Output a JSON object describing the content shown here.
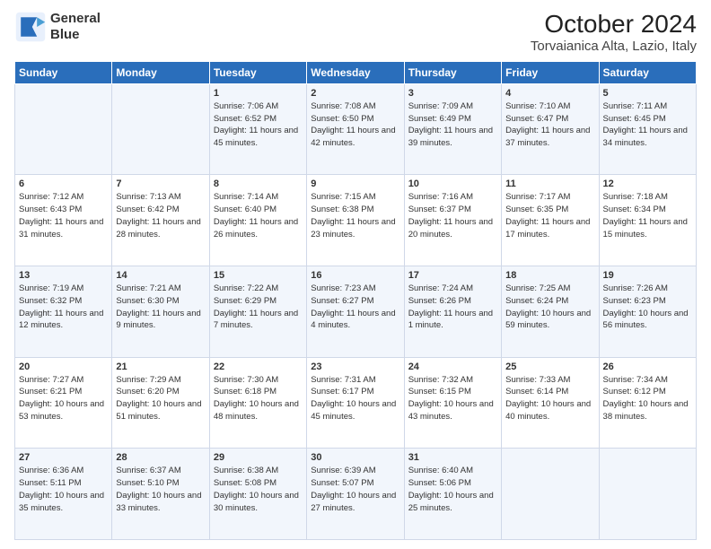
{
  "header": {
    "logo_line1": "General",
    "logo_line2": "Blue",
    "title": "October 2024",
    "subtitle": "Torvaianica Alta, Lazio, Italy"
  },
  "columns": [
    "Sunday",
    "Monday",
    "Tuesday",
    "Wednesday",
    "Thursday",
    "Friday",
    "Saturday"
  ],
  "rows": [
    [
      {
        "day": "",
        "sunrise": "",
        "sunset": "",
        "daylight": ""
      },
      {
        "day": "",
        "sunrise": "",
        "sunset": "",
        "daylight": ""
      },
      {
        "day": "1",
        "sunrise": "Sunrise: 7:06 AM",
        "sunset": "Sunset: 6:52 PM",
        "daylight": "Daylight: 11 hours and 45 minutes."
      },
      {
        "day": "2",
        "sunrise": "Sunrise: 7:08 AM",
        "sunset": "Sunset: 6:50 PM",
        "daylight": "Daylight: 11 hours and 42 minutes."
      },
      {
        "day": "3",
        "sunrise": "Sunrise: 7:09 AM",
        "sunset": "Sunset: 6:49 PM",
        "daylight": "Daylight: 11 hours and 39 minutes."
      },
      {
        "day": "4",
        "sunrise": "Sunrise: 7:10 AM",
        "sunset": "Sunset: 6:47 PM",
        "daylight": "Daylight: 11 hours and 37 minutes."
      },
      {
        "day": "5",
        "sunrise": "Sunrise: 7:11 AM",
        "sunset": "Sunset: 6:45 PM",
        "daylight": "Daylight: 11 hours and 34 minutes."
      }
    ],
    [
      {
        "day": "6",
        "sunrise": "Sunrise: 7:12 AM",
        "sunset": "Sunset: 6:43 PM",
        "daylight": "Daylight: 11 hours and 31 minutes."
      },
      {
        "day": "7",
        "sunrise": "Sunrise: 7:13 AM",
        "sunset": "Sunset: 6:42 PM",
        "daylight": "Daylight: 11 hours and 28 minutes."
      },
      {
        "day": "8",
        "sunrise": "Sunrise: 7:14 AM",
        "sunset": "Sunset: 6:40 PM",
        "daylight": "Daylight: 11 hours and 26 minutes."
      },
      {
        "day": "9",
        "sunrise": "Sunrise: 7:15 AM",
        "sunset": "Sunset: 6:38 PM",
        "daylight": "Daylight: 11 hours and 23 minutes."
      },
      {
        "day": "10",
        "sunrise": "Sunrise: 7:16 AM",
        "sunset": "Sunset: 6:37 PM",
        "daylight": "Daylight: 11 hours and 20 minutes."
      },
      {
        "day": "11",
        "sunrise": "Sunrise: 7:17 AM",
        "sunset": "Sunset: 6:35 PM",
        "daylight": "Daylight: 11 hours and 17 minutes."
      },
      {
        "day": "12",
        "sunrise": "Sunrise: 7:18 AM",
        "sunset": "Sunset: 6:34 PM",
        "daylight": "Daylight: 11 hours and 15 minutes."
      }
    ],
    [
      {
        "day": "13",
        "sunrise": "Sunrise: 7:19 AM",
        "sunset": "Sunset: 6:32 PM",
        "daylight": "Daylight: 11 hours and 12 minutes."
      },
      {
        "day": "14",
        "sunrise": "Sunrise: 7:21 AM",
        "sunset": "Sunset: 6:30 PM",
        "daylight": "Daylight: 11 hours and 9 minutes."
      },
      {
        "day": "15",
        "sunrise": "Sunrise: 7:22 AM",
        "sunset": "Sunset: 6:29 PM",
        "daylight": "Daylight: 11 hours and 7 minutes."
      },
      {
        "day": "16",
        "sunrise": "Sunrise: 7:23 AM",
        "sunset": "Sunset: 6:27 PM",
        "daylight": "Daylight: 11 hours and 4 minutes."
      },
      {
        "day": "17",
        "sunrise": "Sunrise: 7:24 AM",
        "sunset": "Sunset: 6:26 PM",
        "daylight": "Daylight: 11 hours and 1 minute."
      },
      {
        "day": "18",
        "sunrise": "Sunrise: 7:25 AM",
        "sunset": "Sunset: 6:24 PM",
        "daylight": "Daylight: 10 hours and 59 minutes."
      },
      {
        "day": "19",
        "sunrise": "Sunrise: 7:26 AM",
        "sunset": "Sunset: 6:23 PM",
        "daylight": "Daylight: 10 hours and 56 minutes."
      }
    ],
    [
      {
        "day": "20",
        "sunrise": "Sunrise: 7:27 AM",
        "sunset": "Sunset: 6:21 PM",
        "daylight": "Daylight: 10 hours and 53 minutes."
      },
      {
        "day": "21",
        "sunrise": "Sunrise: 7:29 AM",
        "sunset": "Sunset: 6:20 PM",
        "daylight": "Daylight: 10 hours and 51 minutes."
      },
      {
        "day": "22",
        "sunrise": "Sunrise: 7:30 AM",
        "sunset": "Sunset: 6:18 PM",
        "daylight": "Daylight: 10 hours and 48 minutes."
      },
      {
        "day": "23",
        "sunrise": "Sunrise: 7:31 AM",
        "sunset": "Sunset: 6:17 PM",
        "daylight": "Daylight: 10 hours and 45 minutes."
      },
      {
        "day": "24",
        "sunrise": "Sunrise: 7:32 AM",
        "sunset": "Sunset: 6:15 PM",
        "daylight": "Daylight: 10 hours and 43 minutes."
      },
      {
        "day": "25",
        "sunrise": "Sunrise: 7:33 AM",
        "sunset": "Sunset: 6:14 PM",
        "daylight": "Daylight: 10 hours and 40 minutes."
      },
      {
        "day": "26",
        "sunrise": "Sunrise: 7:34 AM",
        "sunset": "Sunset: 6:12 PM",
        "daylight": "Daylight: 10 hours and 38 minutes."
      }
    ],
    [
      {
        "day": "27",
        "sunrise": "Sunrise: 6:36 AM",
        "sunset": "Sunset: 5:11 PM",
        "daylight": "Daylight: 10 hours and 35 minutes."
      },
      {
        "day": "28",
        "sunrise": "Sunrise: 6:37 AM",
        "sunset": "Sunset: 5:10 PM",
        "daylight": "Daylight: 10 hours and 33 minutes."
      },
      {
        "day": "29",
        "sunrise": "Sunrise: 6:38 AM",
        "sunset": "Sunset: 5:08 PM",
        "daylight": "Daylight: 10 hours and 30 minutes."
      },
      {
        "day": "30",
        "sunrise": "Sunrise: 6:39 AM",
        "sunset": "Sunset: 5:07 PM",
        "daylight": "Daylight: 10 hours and 27 minutes."
      },
      {
        "day": "31",
        "sunrise": "Sunrise: 6:40 AM",
        "sunset": "Sunset: 5:06 PM",
        "daylight": "Daylight: 10 hours and 25 minutes."
      },
      {
        "day": "",
        "sunrise": "",
        "sunset": "",
        "daylight": ""
      },
      {
        "day": "",
        "sunrise": "",
        "sunset": "",
        "daylight": ""
      }
    ]
  ]
}
